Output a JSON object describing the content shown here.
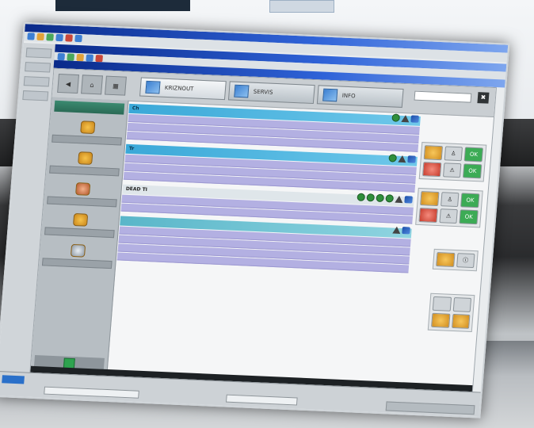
{
  "window": {
    "title1": "",
    "title2": "",
    "title3": ""
  },
  "header": {
    "tabs": [
      {
        "label": "KRIZNOUT"
      },
      {
        "label": "SERVIS"
      },
      {
        "label": "INFO"
      }
    ]
  },
  "sidebar": {
    "heading": "",
    "items": [
      {
        "label": "",
        "icon": "folder-icon"
      },
      {
        "label": "",
        "icon": "folder-icon"
      },
      {
        "label": "",
        "icon": "person-icon"
      },
      {
        "label": "",
        "icon": "folder-icon"
      },
      {
        "label": "",
        "icon": "tools-icon"
      }
    ]
  },
  "sections": [
    {
      "title": "Ch",
      "rows": [
        "",
        "",
        ""
      ],
      "dots": 1
    },
    {
      "title": "Tr",
      "rows": [
        "",
        "",
        ""
      ],
      "dots": 1
    },
    {
      "title": "DEAD TI",
      "rows": [
        "",
        ""
      ],
      "dots": 4
    },
    {
      "title": "",
      "rows": [
        "",
        "",
        "",
        ""
      ],
      "dots": 0
    }
  ],
  "statusbar": {
    "text": ""
  },
  "taskbar": {
    "start": "",
    "items": [
      "",
      ""
    ]
  },
  "colors": {
    "header_blue": "#3aa8d8",
    "row_purple": "#b3b0e2",
    "ok_green": "#2f8f3b"
  }
}
